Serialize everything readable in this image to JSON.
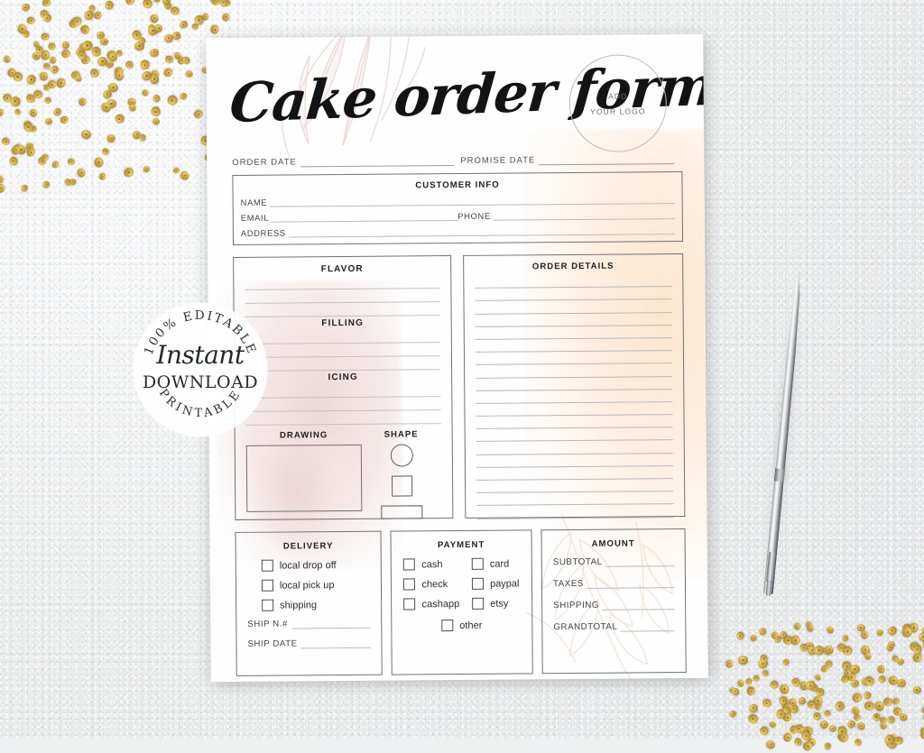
{
  "scene": {
    "background_color": "#eceded",
    "sequin_color": "#cdab49",
    "paper_color": "#fefefe"
  },
  "form": {
    "title": "Cake order form",
    "logo": {
      "line1": "ADD",
      "line2": "YOUR LOGO"
    },
    "dates": [
      {
        "label": "ORDER DATE",
        "value": ""
      },
      {
        "label": "PROMISE DATE",
        "value": ""
      }
    ],
    "customer_info": {
      "title": "CUSTOMER INFO",
      "fields": [
        {
          "label": "NAME",
          "value": ""
        },
        {
          "label": "EMAIL",
          "value": ""
        },
        {
          "label": "PHONE",
          "value": ""
        },
        {
          "label": "ADDRESS",
          "value": ""
        }
      ]
    },
    "flavor_box": {
      "sections": [
        {
          "title": "FLAVOR",
          "lines": 3
        },
        {
          "title": "FILLING",
          "lines": 3
        },
        {
          "title": "ICING",
          "lines": 3
        }
      ],
      "drawing": {
        "label": "DRAWING"
      },
      "shape": {
        "label": "SHAPE",
        "options": [
          "circle",
          "square",
          "rectangle"
        ]
      }
    },
    "order_details": {
      "title": "ORDER DETAILS",
      "lines": 19
    },
    "delivery": {
      "title": "DELIVERY",
      "options": [
        "local drop off",
        "local pick up",
        "shipping"
      ],
      "fields": [
        {
          "label": "SHIP N.#",
          "value": ""
        },
        {
          "label": "SHIP DATE",
          "value": ""
        }
      ]
    },
    "payment": {
      "title": "PAYMENT",
      "column_left": [
        "cash",
        "check",
        "cashapp"
      ],
      "column_right": [
        "card",
        "paypal",
        "etsy"
      ],
      "other": "other"
    },
    "amount": {
      "title": "AMOUNT",
      "rows": [
        {
          "label": "SUBTOTAL",
          "value": ""
        },
        {
          "label": "TAXES",
          "value": ""
        },
        {
          "label": "SHIPPING",
          "value": ""
        },
        {
          "label": "GRANDTOTAL",
          "value": ""
        }
      ]
    }
  },
  "watermark": {
    "arc_top": "100% EDITABLE",
    "script": "Instant",
    "download": "DOWNLOAD",
    "arc_bottom": "PRINTABLE"
  }
}
